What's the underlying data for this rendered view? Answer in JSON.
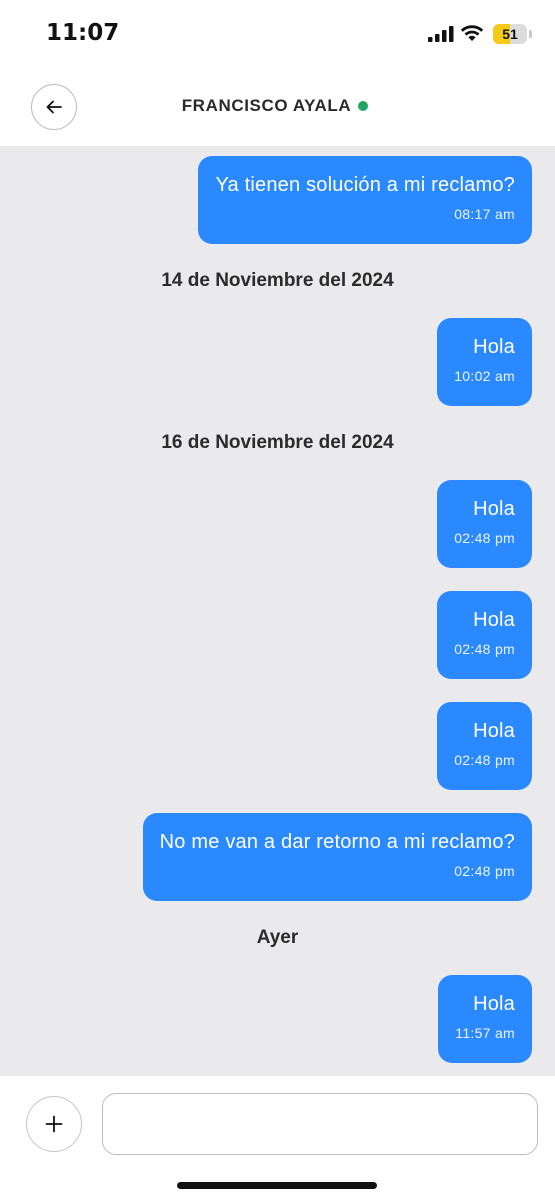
{
  "status_bar": {
    "time": "11:07",
    "battery_level": "51",
    "battery_fraction": 0.51,
    "icons": [
      "signal-icon",
      "wifi-icon",
      "battery-icon"
    ]
  },
  "header": {
    "back_icon": "arrow-left-icon",
    "contact_name": "FRANCISCO AYALA",
    "online_status_color": "#1fa463"
  },
  "messages": [
    {
      "type": "message",
      "text": "Ya tienen solución a mi reclamo?",
      "time": "08:17 am"
    },
    {
      "type": "date",
      "text": "14 de Noviembre del 2024"
    },
    {
      "type": "message",
      "text": "Hola",
      "time": "10:02 am"
    },
    {
      "type": "date",
      "text": "16 de Noviembre del 2024"
    },
    {
      "type": "message",
      "text": "Hola",
      "time": "02:48 pm"
    },
    {
      "type": "message",
      "text": "Hola",
      "time": "02:48 pm"
    },
    {
      "type": "message",
      "text": "Hola",
      "time": "02:48 pm"
    },
    {
      "type": "message",
      "text": "No me van a dar retorno a mi reclamo?",
      "time": "02:48 pm"
    },
    {
      "type": "date",
      "text": "Ayer"
    },
    {
      "type": "message",
      "text": "Hola",
      "time": "11:57 am"
    }
  ],
  "composer": {
    "add_icon": "plus-icon",
    "input_value": "",
    "input_placeholder": ""
  },
  "colors": {
    "bubble": "#2a89ff",
    "chat_background": "#eaeaec",
    "battery_accent": "#f6cb18"
  }
}
